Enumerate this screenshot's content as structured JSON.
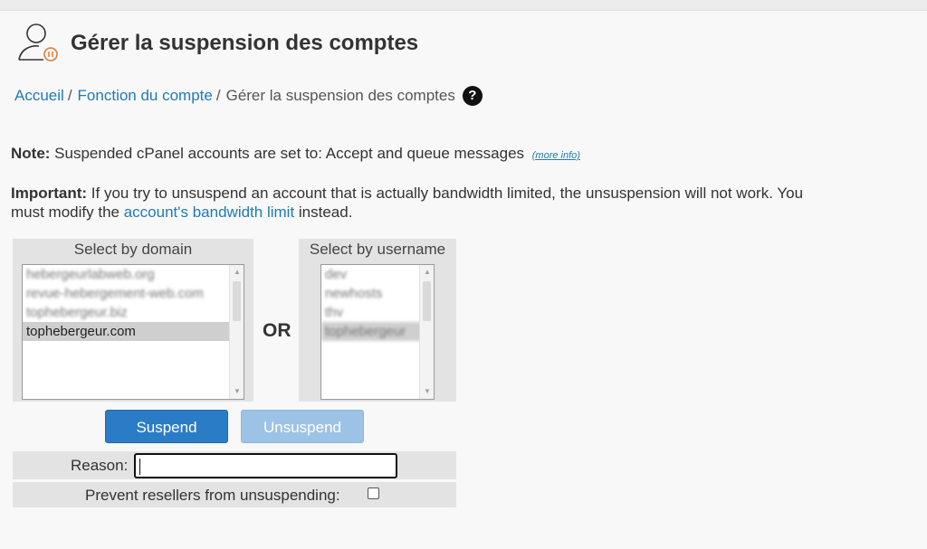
{
  "header": {
    "title": "Gérer la suspension des comptes",
    "icon": "user-pause-icon"
  },
  "breadcrumb": {
    "home": "Accueil",
    "section": "Fonction du compte",
    "current": "Gérer la suspension des comptes",
    "separator": "/",
    "help": "?"
  },
  "note": {
    "label": "Note:",
    "text": " Suspended cPanel accounts are set to: Accept and queue messages",
    "more": "(more info)"
  },
  "important": {
    "label": "Important:",
    "text_before": " If you try to unsuspend an account that is actually bandwidth limited, the unsuspension will not work. You must modify the ",
    "link": "account's bandwidth limit",
    "text_after": " instead."
  },
  "domain_select": {
    "title": "Select by domain",
    "options": [
      "hebergeurlabweb.org",
      "revue-hebergement-web.com",
      "tophebergeur.biz",
      "tophebergeur.com"
    ],
    "selected": "tophebergeur.com"
  },
  "or_label": "OR",
  "username_select": {
    "title": "Select by username",
    "options": [
      "dev",
      "newhosts",
      "thv",
      "tophebergeur"
    ],
    "selected": "tophebergeur"
  },
  "buttons": {
    "suspend": "Suspend",
    "unsuspend": "Unsuspend"
  },
  "reason": {
    "label": "Reason:",
    "value": ""
  },
  "prevent": {
    "label": "Prevent resellers from unsuspending:",
    "checked": false
  },
  "colors": {
    "link": "#1f7ab8",
    "primary_button": "#2b7cc7",
    "disabled_button": "#9cc3e6"
  }
}
